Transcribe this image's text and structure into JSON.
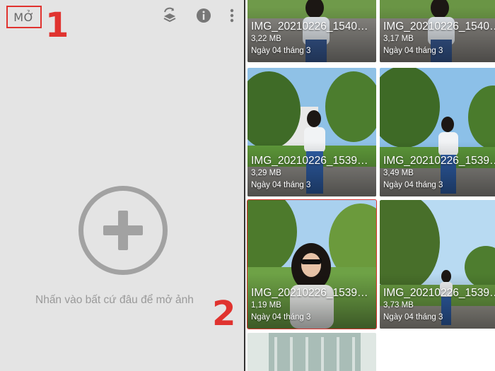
{
  "toolbar": {
    "open_label": "MỞ",
    "icons": [
      "styles-icon",
      "info-icon",
      "more-vert-icon"
    ]
  },
  "annotations": {
    "step1": "1",
    "step2": "2",
    "color": "#e0332f"
  },
  "empty_state": {
    "hint": "Nhấn vào bất cứ đâu để mở ảnh",
    "icon": "add-circle-icon"
  },
  "gallery": {
    "items": [
      {
        "name": "IMG_20210226_1540…",
        "size": "3,22 MB",
        "date": "Ngày 04 tháng 3"
      },
      {
        "name": "IMG_20210226_1540…",
        "size": "3,17 MB",
        "date": "Ngày 04 tháng 3"
      },
      {
        "name": "IMG_20210226_1539…",
        "size": "3,29 MB",
        "date": "Ngày 04 tháng 3"
      },
      {
        "name": "IMG_20210226_1539…",
        "size": "3,49 MB",
        "date": "Ngày 04 tháng 3"
      },
      {
        "name": "IMG_20210226_1539…",
        "size": "1,19 MB",
        "date": "Ngày 04 tháng 3"
      },
      {
        "name": "IMG_20210226_1539…",
        "size": "3,73 MB",
        "date": "Ngày 04 tháng 3"
      }
    ]
  }
}
